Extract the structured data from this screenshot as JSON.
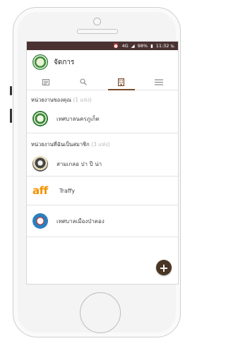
{
  "status": {
    "signal": "4G",
    "battery": "98%",
    "time": "11:32 น."
  },
  "appbar": {
    "title": "จัดการ"
  },
  "tabs": [
    {
      "icon": "newspaper-icon",
      "active": false
    },
    {
      "icon": "search-icon",
      "active": false
    },
    {
      "icon": "building-icon",
      "active": true
    },
    {
      "icon": "menu-icon",
      "active": false
    }
  ],
  "section_mine": {
    "title": "หน่วยงานของคุณ",
    "count": "(1 แห่ง)",
    "items": [
      {
        "label": "เทศบาลนครภูเก็ต"
      }
    ]
  },
  "section_member": {
    "title": "หน่วยงานที่ฉันเป็นสมาชิก",
    "count": "(3 แห่ง)",
    "items": [
      {
        "label": "สามเกลอ ปา ปี น่า"
      },
      {
        "logo_text": "aff",
        "label": "Traffy"
      },
      {
        "label": "เทศบาลเมืองป่าตอง"
      }
    ]
  },
  "fab": {
    "symbol": "+"
  },
  "colors": {
    "statusbar": "#4a3232",
    "accent": "#7a4a2a",
    "fab": "#4a3624",
    "aff_logo": "#f39200"
  }
}
